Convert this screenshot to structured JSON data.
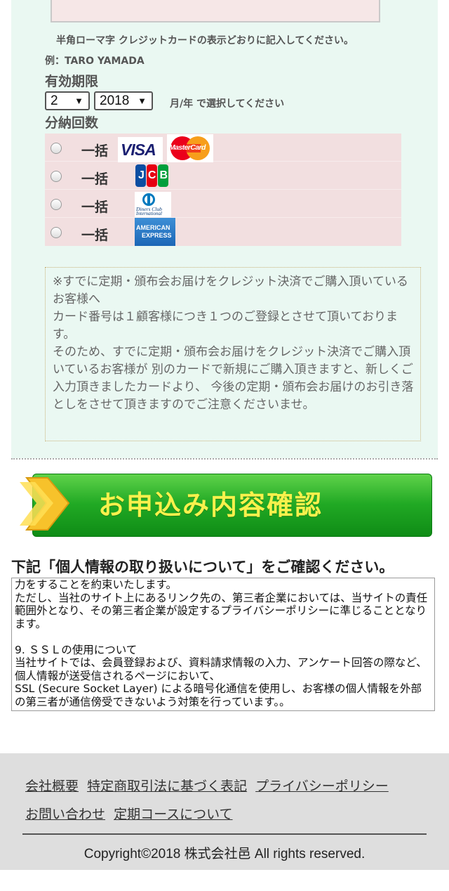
{
  "card_form": {
    "name_hint": "半角ローマ字 クレジットカードの表示どおりに記入してください。",
    "name_example": "例：TARO YAMADA",
    "expiry_label": "有効期限",
    "expiry_month": "2",
    "expiry_year": "2018",
    "expiry_help": "月/年 で選択してください",
    "installments_label": "分納回数",
    "installment_options": [
      {
        "label": "一括",
        "brands": [
          "VISA",
          "MasterCard"
        ]
      },
      {
        "label": "一括",
        "brands": [
          "JCB"
        ]
      },
      {
        "label": "一括",
        "brands": [
          "Diners Club International"
        ]
      },
      {
        "label": "一括",
        "brands": [
          "AMERICAN EXPRESS"
        ]
      }
    ],
    "brand_text": {
      "visa": "VISA",
      "mastercard": "MasterCard",
      "jcb": "JCB",
      "diners_line1": "Diners Club",
      "diners_line2": "International",
      "amex_line1": "AMERICAN",
      "amex_line2": "EXPRESS"
    },
    "notice": "※すでに定期・頒布会お届けをクレジット決済でご購入頂いているお客様へ\nカード番号は１顧客様につき１つのご登録とさせて頂いております。\nそのため、すでに定期・頒布会お届けをクレジット決済でご購入頂いているお客様が 別のカードで新規にご購入頂きますと、新しくご入力頂きましたカードより、 今後の定期・頒布会お届けのお引き落としをさせて頂きますのでご注意くださいませ。"
  },
  "cta": {
    "label": "お申込み内容確認"
  },
  "privacy": {
    "title": "下記「個人情報の取り扱いについて」をご確認ください。",
    "body": "力をすることを約束いたします。\nただし、当社のサイト上にあるリンク先の、第三者企業においては、当サイトの責任範囲外となり、その第三者企業が設定するプライバシーポリシーに準じることとなります。\n\n9. ＳＳＬの使用について\n当社サイトでは、会員登録および、資料請求情報の入力、アンケート回答の際など、個人情報が送受信されるページにおいて、\nSSL (Secure Socket Layer) による暗号化通信を使用し、お客様の個人情報を外部の第三者が通信傍受できないよう対策を行っています。。"
  },
  "footer": {
    "links": [
      "会社概要",
      "特定商取引法に基づく表記",
      "プライバシーポリシー",
      "お問い合わせ",
      "定期コースについて"
    ],
    "copyright": "Copyright©2018 株式会社邑 All rights reserved."
  },
  "colors": {
    "mint_bg": "#eaf8f2",
    "row_pink": "#f2dfe0",
    "cta_green": "#21a924",
    "cta_text": "#f8f14c",
    "footer_bg": "#dedede"
  }
}
